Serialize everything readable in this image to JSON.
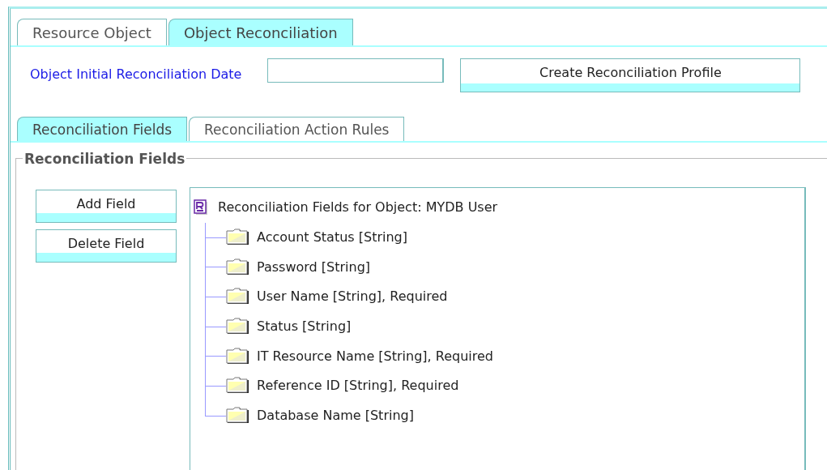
{
  "tabs": [
    {
      "label": "Resource Object",
      "selected": false
    },
    {
      "label": "Object Reconciliation",
      "selected": true
    }
  ],
  "date_field": {
    "label": "Object Initial Reconciliation Date"
  },
  "profile_button": {
    "label": "Create Reconciliation Profile"
  },
  "sub_tabs": [
    {
      "label": "Reconciliation Fields",
      "selected": true
    },
    {
      "label": "Reconciliation Action Rules",
      "selected": false
    }
  ],
  "group": {
    "title": "Reconciliation Fields",
    "buttons": [
      {
        "label": "Add Field"
      },
      {
        "label": "Delete Field"
      }
    ],
    "tree": {
      "root": "Reconciliation Fields for Object: MYDB User",
      "children": [
        {
          "label": "Account Status [String]"
        },
        {
          "label": "Password [String]"
        },
        {
          "label": "User Name [String], Required"
        },
        {
          "label": "Status [String]"
        },
        {
          "label": "IT Resource Name [String], Required"
        },
        {
          "label": "Reference ID [String], Required"
        },
        {
          "label": "Database Name [String]"
        }
      ]
    }
  }
}
